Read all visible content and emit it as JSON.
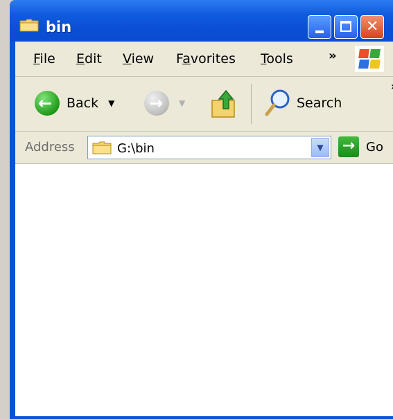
{
  "window": {
    "title": "bin"
  },
  "menu": {
    "items": [
      {
        "label": "File",
        "accel": "F",
        "rest": "ile"
      },
      {
        "label": "Edit",
        "accel": "E",
        "rest": "dit"
      },
      {
        "label": "View",
        "accel": "V",
        "rest": "iew"
      },
      {
        "label": "Favorites",
        "pre": "F",
        "accel": "a",
        "rest": "vorites"
      },
      {
        "label": "Tools",
        "accel": "T",
        "rest": "ools"
      }
    ],
    "overflow": "»"
  },
  "toolbar": {
    "back_label": "Back",
    "search_label": "Search",
    "overflow": "»"
  },
  "address": {
    "label": "Address",
    "value": "G:\\bin",
    "go_label": "Go"
  },
  "colors": {
    "title_bar": "#0a4fd6",
    "menu_bg": "#ece9d8",
    "desktop_bg": "#d4d0c8"
  },
  "icons": {
    "title": "folder-icon",
    "back": "back-arrow-icon",
    "forward": "forward-arrow-icon",
    "up": "up-folder-icon",
    "search": "magnifier-icon",
    "go": "go-arrow-icon",
    "logo": "windows-logo-icon"
  }
}
